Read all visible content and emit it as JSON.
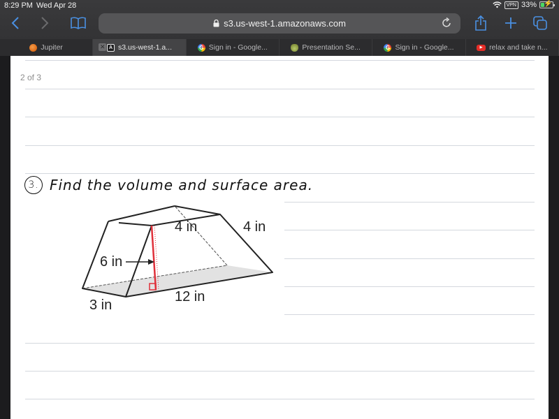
{
  "status_bar": {
    "time": "8:29 PM",
    "date": "Wed Apr 28",
    "vpn_label": "VPN",
    "battery_percent": "33%",
    "battery_level": 0.33,
    "charging": true
  },
  "toolbar": {
    "back_icon": "chevron-left-icon",
    "forward_icon": "chevron-right-icon",
    "bookmarks_icon": "book-icon",
    "url": "s3.us-west-1.amazonaws.com",
    "share_icon": "share-icon",
    "new_tab_icon": "plus-icon",
    "tabs_icon": "tabs-icon"
  },
  "tabs": [
    {
      "label": "Jupiter",
      "favicon": "jupiter-icon",
      "active": false
    },
    {
      "label": "s3.us-west-1.a...",
      "favicon": "a-icon",
      "active": true,
      "closable": true
    },
    {
      "label": "Sign in - Google...",
      "favicon": "google-icon",
      "active": false
    },
    {
      "label": "Presentation Se...",
      "favicon": "presentation-icon",
      "active": false
    },
    {
      "label": "Sign in - Google...",
      "favicon": "google-icon",
      "active": false
    },
    {
      "label": "relax and take n...",
      "favicon": "youtube-icon",
      "active": false
    }
  ],
  "document": {
    "page_indicator": "2 of 3",
    "problem_number": "3.",
    "problem_text": "Find the volume and surface area.",
    "figure": {
      "description": "Trapezoidal prism",
      "labels": {
        "height": "6 in",
        "top_width": "4 in",
        "slant_side": "4 in",
        "bottom_width": "3 in",
        "length": "12 in"
      },
      "height_line_color": "#e0303a"
    }
  }
}
